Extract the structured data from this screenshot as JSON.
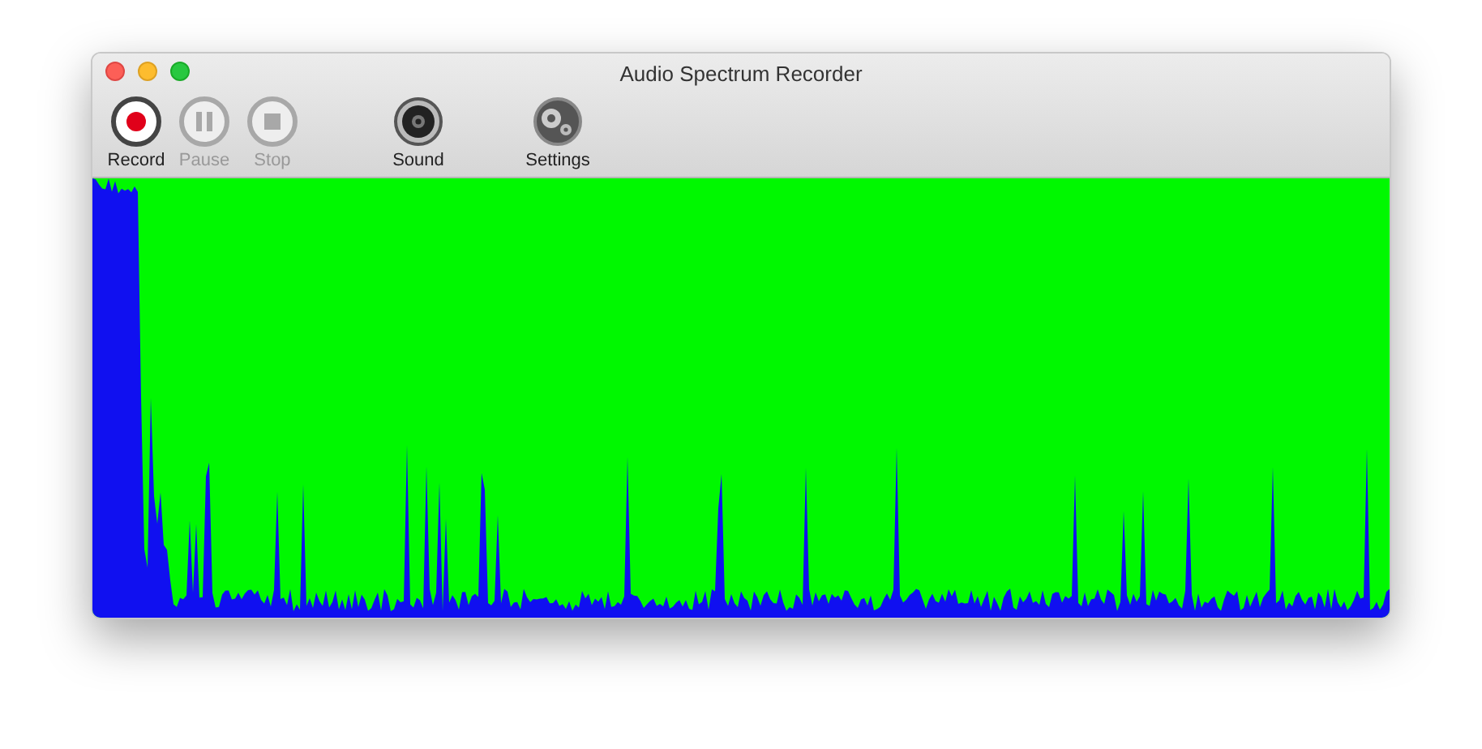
{
  "window": {
    "title": "Audio Spectrum Recorder"
  },
  "toolbar": [
    {
      "kind": "record",
      "label": "Record",
      "disabled": false
    },
    {
      "kind": "pause",
      "label": "Pause",
      "disabled": true
    },
    {
      "kind": "stop",
      "label": "Stop",
      "disabled": true
    },
    {
      "kind": "sound",
      "label": "Sound",
      "disabled": false
    },
    {
      "kind": "settings",
      "label": "Settings",
      "disabled": false
    }
  ]
}
